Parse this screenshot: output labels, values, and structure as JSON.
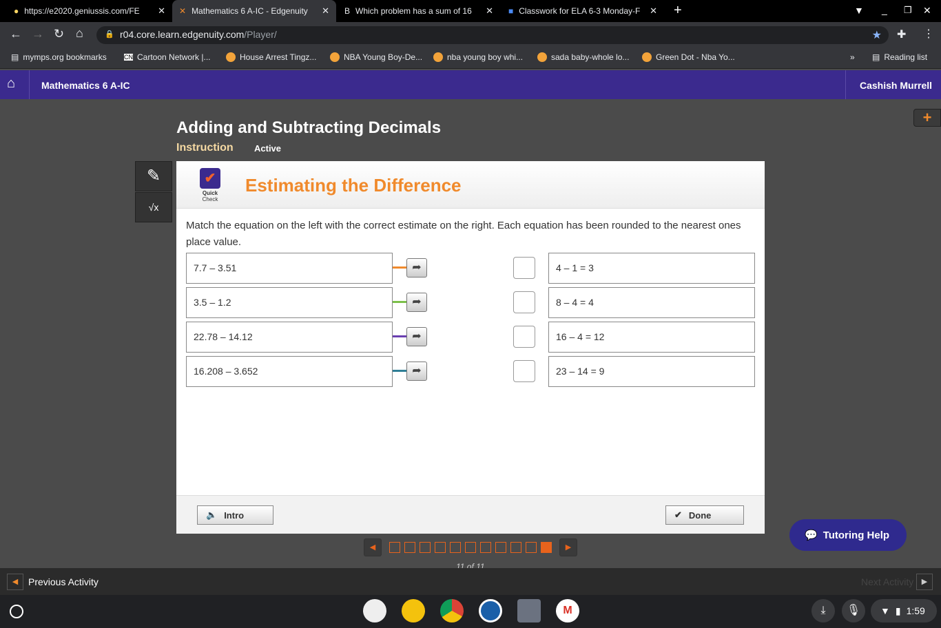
{
  "browser": {
    "tabs": [
      {
        "title": "https://e2020.geniussis.com/FE"
      },
      {
        "title": "Mathematics 6 A-IC - Edgenuity"
      },
      {
        "title": "Which problem has a sum of 16"
      },
      {
        "title": "Classwork for ELA 6-3 Monday-F"
      }
    ],
    "url_host": "r04.core.learn.edgenuity.com",
    "url_path": "/Player/",
    "bookmarks": [
      "mymps.org bookmarks",
      "Cartoon Network |...",
      "House Arrest Tingz...",
      "NBA Young Boy-De...",
      "nba young boy whi...",
      "sada baby-whole lo...",
      "Green Dot - Nba Yo..."
    ],
    "reading_list": "Reading list"
  },
  "app": {
    "course": "Mathematics 6 A-IC",
    "user": "Cashish Murrell"
  },
  "lesson": {
    "title": "Adding and Subtracting Decimals",
    "section": "Instruction",
    "status": "Active"
  },
  "activity": {
    "badge_line1": "Quick",
    "badge_line2": "Check",
    "title": "Estimating the Difference",
    "prompt": "Match the equation on the left with the correct estimate on the right. Each equation has been rounded to the nearest ones place value.",
    "left": [
      "7.7 – 3.51",
      "3.5 – 1.2",
      "22.78 – 14.12",
      "16.208 – 3.652"
    ],
    "right": [
      "4 – 1 = 3",
      "8 – 4 = 4",
      "16 – 4 = 12",
      "23 – 14 = 9"
    ],
    "line_colors": [
      "#f08a2c",
      "#7cc04a",
      "#6a3fb0",
      "#2f7f96"
    ],
    "intro_label": "Intro",
    "done_label": "Done"
  },
  "pager": {
    "total": 11,
    "current": 11,
    "label": "11 of 11"
  },
  "tutoring_label": "Tutoring Help",
  "nav": {
    "prev": "Previous Activity",
    "next": "Next Activity"
  },
  "clock": "1:59"
}
